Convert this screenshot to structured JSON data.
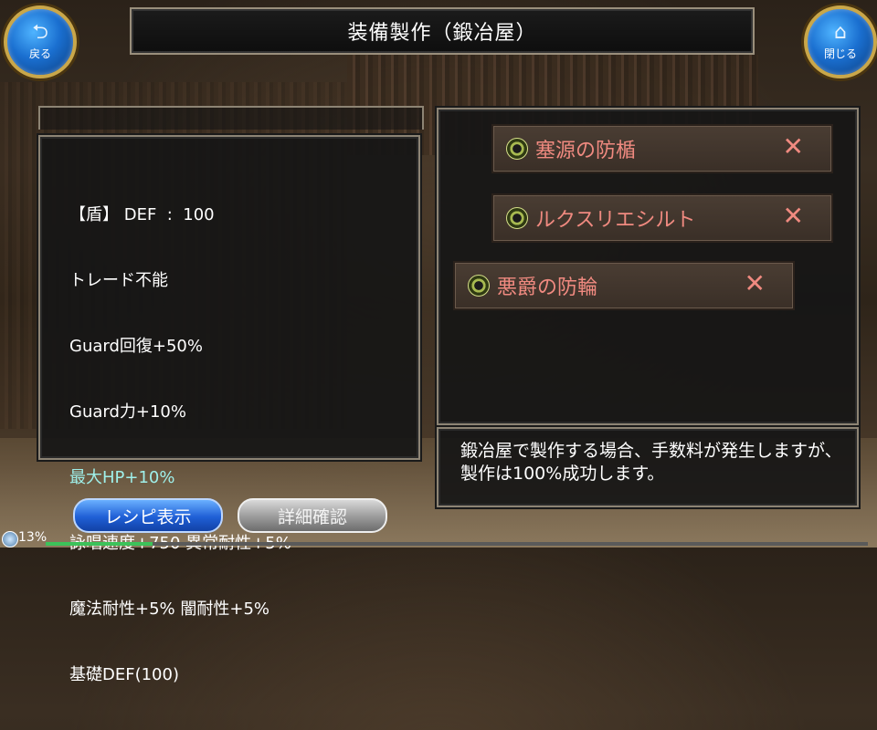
{
  "header": {
    "title": "装備製作（鍛冶屋）",
    "back_label": "戻る",
    "close_label": "閉じる"
  },
  "stats": {
    "lines": [
      "【盾】 DEF  :  100",
      "トレード不能",
      "Guard回復+50%",
      "Guard力+10%",
      "最大HP+10%",
      "詠唱速度+750 異常耐性+5%",
      "魔法耐性+5% 闇耐性+5%",
      "基礎DEF(100)"
    ]
  },
  "materials": [
    {
      "name": "塞源の防楯",
      "remove": "✕"
    },
    {
      "name": "ルクスリエシルト",
      "remove": "✕"
    },
    {
      "name": "悪爵の防輪",
      "remove": "✕"
    }
  ],
  "info": {
    "text": "鍛冶屋で製作する場合、手数料が発生しますが、製作は100%成功します。"
  },
  "buttons": {
    "recipe": "レシピ表示",
    "detail": "詳細確認"
  },
  "status": {
    "progress_label": "13%",
    "progress_value": 0.13
  },
  "colors": {
    "material_text": "#f08a80",
    "highlight_stat": "#9ff0ea",
    "button_blue": "#1f5fd6"
  },
  "icons": {
    "back": "return-arrow-icon",
    "close": "home-icon",
    "material": "gem-icon"
  }
}
